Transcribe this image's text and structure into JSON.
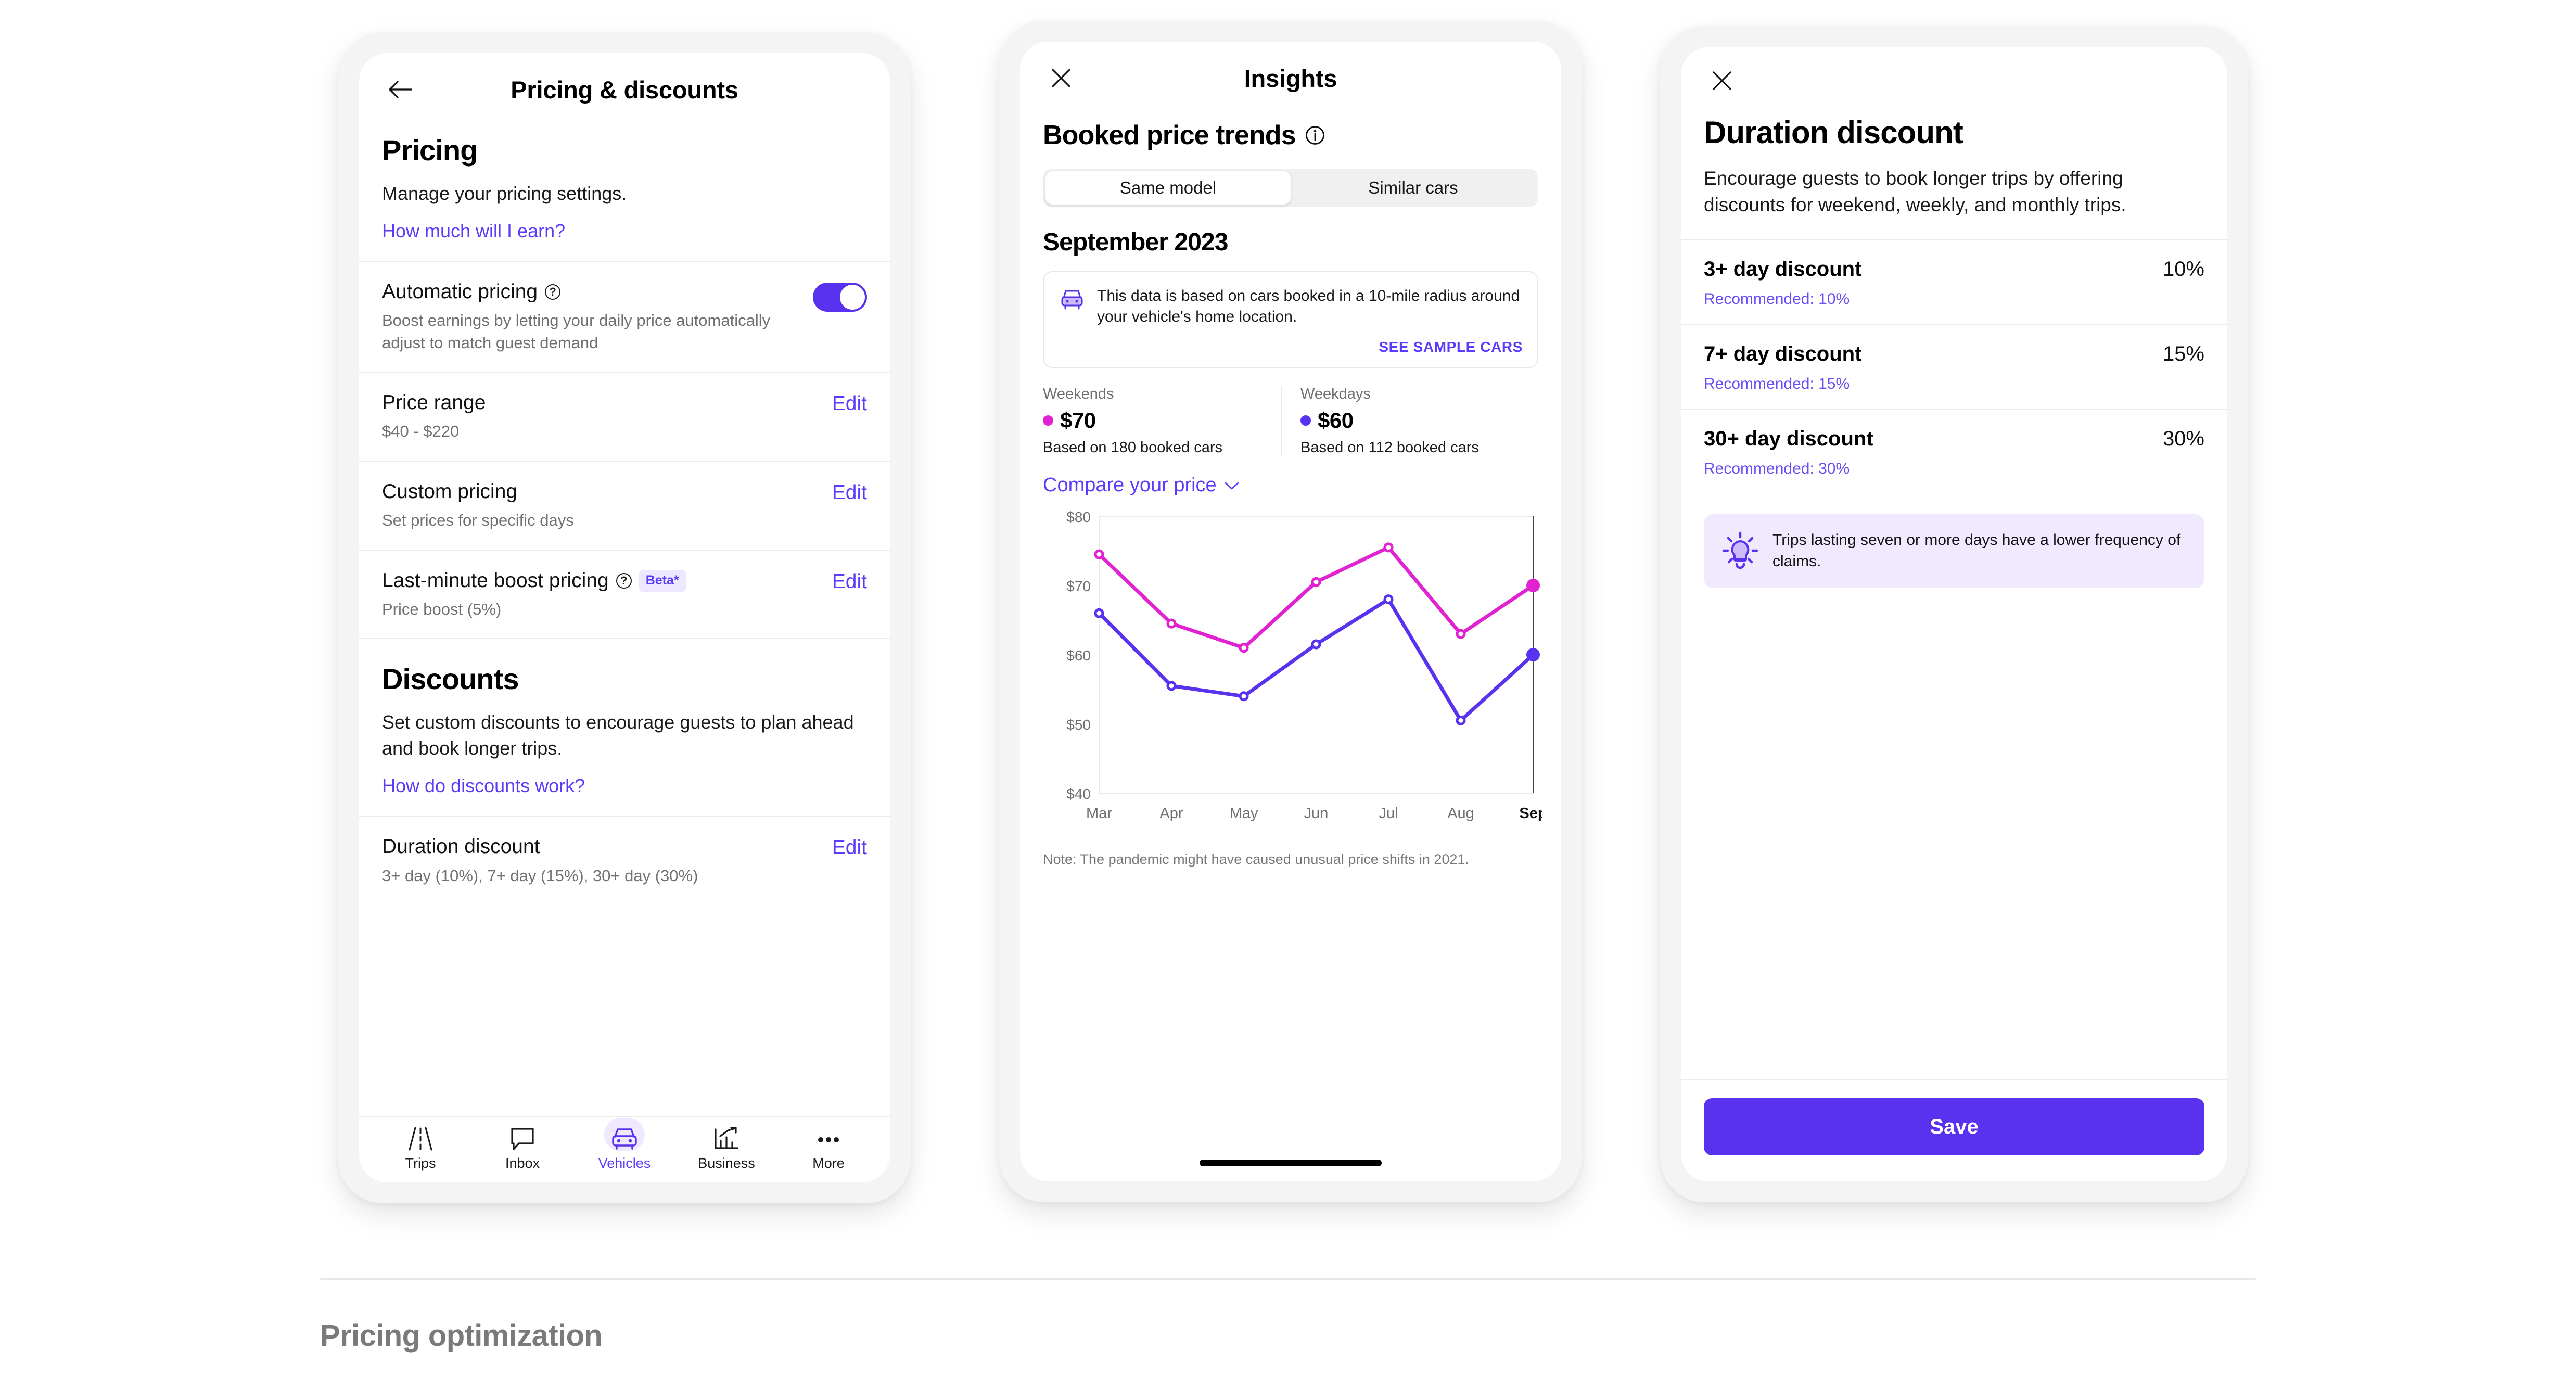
{
  "phone1": {
    "nav": {
      "back_icon": "arrow-left-icon",
      "title": "Pricing & discounts"
    },
    "pricing": {
      "heading": "Pricing",
      "description": "Manage your pricing settings.",
      "link": "How much will I earn?"
    },
    "automatic_pricing": {
      "title": "Automatic pricing",
      "help_icon": "question-mark-icon",
      "subtitle": "Boost earnings by letting your daily price automatically adjust to match guest demand",
      "toggle_on": true
    },
    "rows": [
      {
        "title": "Price range",
        "subtitle": "$40 - $220",
        "action": "Edit"
      },
      {
        "title": "Custom pricing",
        "subtitle": "Set prices for specific days",
        "action": "Edit"
      },
      {
        "title": "Last-minute boost pricing",
        "badge": "Beta*",
        "subtitle": "Price boost (5%)",
        "action": "Edit"
      }
    ],
    "discounts": {
      "heading": "Discounts",
      "description": "Set custom discounts to encourage guests to plan ahead and book longer trips.",
      "link": "How do discounts work?",
      "row": {
        "title": "Duration discount",
        "subtitle": "3+ day (10%), 7+ day (15%), 30+ day (30%)",
        "action": "Edit"
      }
    },
    "tabs": [
      {
        "label": "Trips",
        "icon": "road-icon",
        "active": false
      },
      {
        "label": "Inbox",
        "icon": "chat-bubble-icon",
        "active": false
      },
      {
        "label": "Vehicles",
        "icon": "car-icon",
        "active": true
      },
      {
        "label": "Business",
        "icon": "bar-chart-arrow-icon",
        "active": false
      },
      {
        "label": "More",
        "icon": "ellipsis-icon",
        "active": false
      }
    ]
  },
  "phone2": {
    "nav": {
      "close_icon": "close-icon",
      "title": "Insights"
    },
    "section_title": "Booked price trends",
    "info_icon": "info-circle-icon",
    "segments": [
      {
        "label": "Same model",
        "selected": true
      },
      {
        "label": "Similar cars",
        "selected": false
      }
    ],
    "month": "September 2023",
    "info_card": {
      "icon": "car-front-icon",
      "text": "This data is based on cars booked in a 10-mile radius around your vehicle's home location.",
      "link": "SEE SAMPLE CARS"
    },
    "stats": [
      {
        "label": "Weekends",
        "value": "$70",
        "sub": "Based on 180 booked cars",
        "color": "#e022d0"
      },
      {
        "label": "Weekdays",
        "value": "$60",
        "sub": "Based on 112 booked cars",
        "color": "#5932f0"
      }
    ],
    "compare": {
      "label": "Compare your price",
      "icon": "chevron-down-icon"
    },
    "note": "Note: The pandemic might have caused unusual price shifts in 2021."
  },
  "phone3": {
    "nav": {
      "close_icon": "close-icon"
    },
    "title": "Duration discount",
    "description": "Encourage guests to book longer trips by offering discounts for weekend, weekly, and monthly trips.",
    "discounts": [
      {
        "title": "3+ day discount",
        "value": "10%",
        "recommended": "Recommended: 10%"
      },
      {
        "title": "7+ day discount",
        "value": "15%",
        "recommended": "Recommended: 15%"
      },
      {
        "title": "30+ day discount",
        "value": "30%",
        "recommended": "Recommended: 30%"
      }
    ],
    "tip": {
      "icon": "lightbulb-icon",
      "text": "Trips lasting seven or more days have a lower frequency of claims."
    },
    "save_label": "Save"
  },
  "footer": {
    "title": "Pricing optimization"
  },
  "colors": {
    "accent_purple": "#593cfb",
    "toggle_purple": "#5932f0",
    "magenta": "#e022d0",
    "tip_bg": "#f1e9fe",
    "beta_bg": "#ede8ff"
  },
  "chart_data": {
    "type": "line",
    "title": "Booked price trends",
    "xlabel": "",
    "ylabel": "",
    "x": [
      "Mar",
      "Apr",
      "May",
      "Jun",
      "Jul",
      "Aug",
      "Sep"
    ],
    "categories": [
      "Mar",
      "Apr",
      "May",
      "Jun",
      "Jul",
      "Aug",
      "Sep"
    ],
    "ylim": [
      40,
      80
    ],
    "yticks": [
      40,
      50,
      60,
      70,
      80
    ],
    "ytick_labels": [
      "$40",
      "$50",
      "$60",
      "$70",
      "$80"
    ],
    "grid": false,
    "legend": "external",
    "highlight_x": "Sep",
    "series": [
      {
        "name": "Weekends",
        "color": "#e022d0",
        "values": [
          74.5,
          64.5,
          61.0,
          70.5,
          75.5,
          63.0,
          70.0
        ]
      },
      {
        "name": "Weekdays",
        "color": "#5932f0",
        "values": [
          66.0,
          55.5,
          54.0,
          61.5,
          68.0,
          50.5,
          60.0
        ]
      }
    ]
  }
}
